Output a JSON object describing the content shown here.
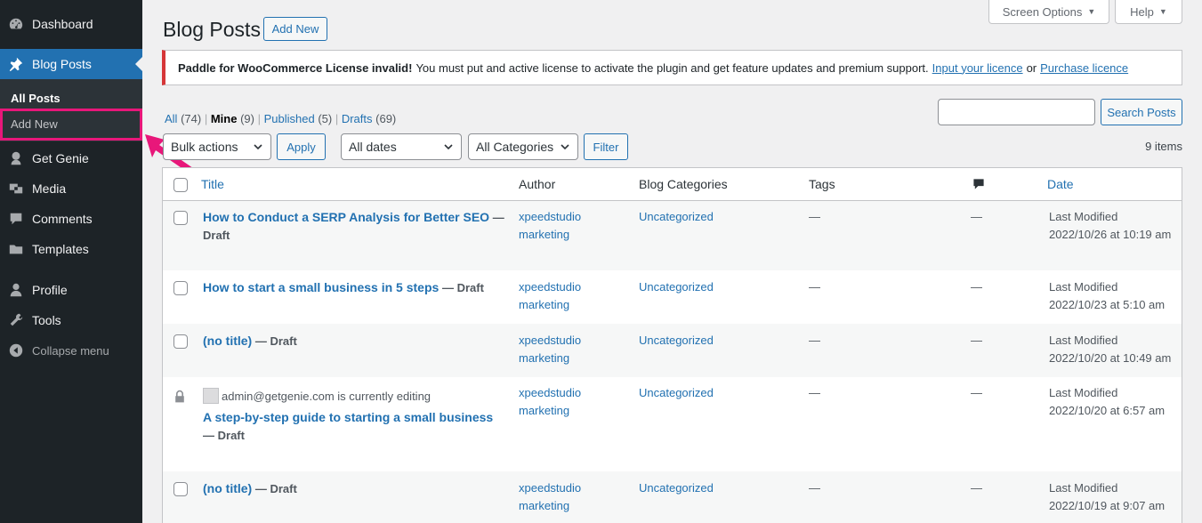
{
  "sidebar": {
    "items": [
      {
        "label": "Dashboard",
        "icon": "dashboard-icon"
      },
      {
        "label": "Blog Posts",
        "icon": "pin-icon"
      },
      {
        "label": "Get Genie",
        "icon": "genie-icon"
      },
      {
        "label": "Media",
        "icon": "media-icon"
      },
      {
        "label": "Comments",
        "icon": "comment-icon"
      },
      {
        "label": "Templates",
        "icon": "folder-icon"
      },
      {
        "label": "Profile",
        "icon": "user-icon"
      },
      {
        "label": "Tools",
        "icon": "wrench-icon"
      },
      {
        "label": "Collapse menu",
        "icon": "collapse-icon"
      }
    ],
    "submenu": [
      "All Posts",
      "Add New"
    ]
  },
  "top": {
    "screen_options": "Screen Options",
    "help": "Help"
  },
  "page": {
    "title": "Blog Posts",
    "add_new": "Add New"
  },
  "notice": {
    "bold": "Paddle for WooCommerce License invalid!",
    "text": "You must put and active license to activate the plugin and get feature updates and premium support.",
    "link1": "Input your licence",
    "or": "or",
    "link2": "Purchase licence"
  },
  "views": {
    "all": "All",
    "all_count": "(74)",
    "mine": "Mine",
    "mine_count": "(9)",
    "published": "Published",
    "published_count": "(5)",
    "drafts": "Drafts",
    "drafts_count": "(69)"
  },
  "search": {
    "button": "Search Posts",
    "value": ""
  },
  "filters": {
    "bulk": "Bulk actions",
    "apply": "Apply",
    "dates": "All dates",
    "categories": "All Categories",
    "filter": "Filter",
    "items": "9 items"
  },
  "table": {
    "headers": {
      "title": "Title",
      "author": "Author",
      "categories": "Blog Categories",
      "tags": "Tags",
      "date": "Date"
    },
    "rows": [
      {
        "title": "How to Conduct a SERP Analysis for Better SEO",
        "state": "Draft",
        "author1": "xpeedstudio",
        "author2": "marketing",
        "category": "Uncategorized",
        "tags": "—",
        "comments": "—",
        "date_label": "Last Modified",
        "date": "2022/10/26 at 10:19 am"
      },
      {
        "title": "How to start a small business in 5 steps",
        "state": "Draft",
        "author1": "xpeedstudio",
        "author2": "marketing",
        "category": "Uncategorized",
        "tags": "—",
        "comments": "—",
        "date_label": "Last Modified",
        "date": "2022/10/23 at 5:10 am"
      },
      {
        "title": "(no title)",
        "state": "Draft",
        "author1": "xpeedstudio",
        "author2": "marketing",
        "category": "Uncategorized",
        "tags": "—",
        "comments": "—",
        "date_label": "Last Modified",
        "date": "2022/10/20 at 10:49 am"
      },
      {
        "editing": "admin@getgenie.com is currently editing",
        "title": "A step-by-step guide to starting a small business",
        "state": "Draft",
        "author1": "xpeedstudio",
        "author2": "marketing",
        "category": "Uncategorized",
        "tags": "—",
        "comments": "—",
        "date_label": "Last Modified",
        "date": "2022/10/20 at 6:57 am"
      },
      {
        "title": "(no title)",
        "state": "Draft",
        "author1": "xpeedstudio",
        "author2": "marketing",
        "category": "Uncategorized",
        "tags": "—",
        "comments": "—",
        "date_label": "Last Modified",
        "date": "2022/10/19 at 9:07 am"
      }
    ]
  },
  "colors": {
    "accent": "#2271b1",
    "sidebar": "#1d2327",
    "highlight": "#e8177a",
    "error": "#d63638"
  }
}
